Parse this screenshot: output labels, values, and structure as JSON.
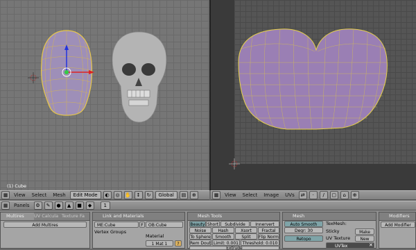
{
  "view3d": {
    "object_label": "(1) Cube",
    "header": {
      "view": "View",
      "select": "Select",
      "mesh": "Mesh",
      "mode": "Edit Mode",
      "orientation": "Global"
    }
  },
  "uv_editor": {
    "header": {
      "view": "View",
      "select": "Select",
      "image": "Image",
      "uvs": "UVs"
    }
  },
  "buttons_header": {
    "panels": "Panels",
    "frame": "1"
  },
  "panels": {
    "multires": {
      "tab1": "Multires",
      "tab2": "UV Calcula",
      "tab3": "Texture Fa",
      "add": "Add Multires"
    },
    "link": {
      "title": "Link and Materials",
      "me": "ME:Cube",
      "f": "F",
      "ob": "OB:Cube",
      "vgroups": "Vertex Groups",
      "material": "Material",
      "mat": "1 Mat 1",
      "q": "?"
    },
    "mesh_tools": {
      "title": "Mesh Tools",
      "row1": [
        "Beauty",
        "Short",
        "Subdivide",
        "Innervert"
      ],
      "row2": [
        "Noise",
        "Hash",
        "Xsort",
        "Fractal"
      ],
      "row3": [
        "To Sphere",
        "Smooth",
        "Split",
        "Flip Normal"
      ],
      "row4": [
        "Rem Doubl",
        "Limit: 0.001",
        "Threshold: 0.010"
      ],
      "extrude": "Extrude"
    },
    "mesh": {
      "title": "Mesh",
      "autosmooth": "Auto Smooth",
      "degr": "Degr: 30",
      "retopo": "Retopo",
      "texmesh": "TexMesh:",
      "sticky": "Sticky",
      "make": "Make",
      "uvtexture": "UV Texture",
      "new": "New",
      "uvtex": "UVTex"
    },
    "modifiers": {
      "title": "Modifiers",
      "add": "Add Modifier"
    }
  }
}
